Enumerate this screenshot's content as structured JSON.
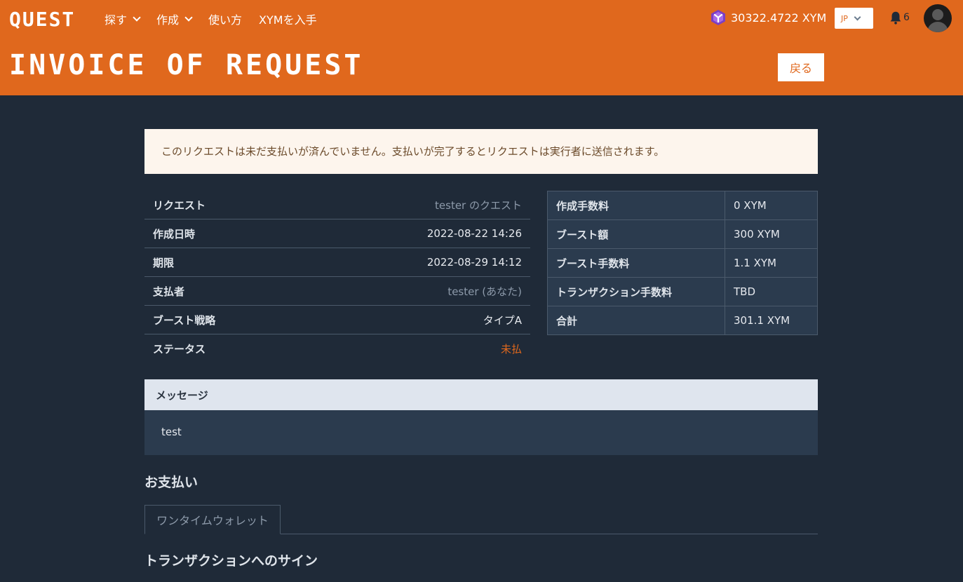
{
  "header": {
    "logo": "QUEST",
    "nav": [
      {
        "label": "探す",
        "dropdown": true
      },
      {
        "label": "作成",
        "dropdown": true
      },
      {
        "label": "使い方",
        "dropdown": false
      },
      {
        "label": "XYMを入手",
        "dropdown": false
      }
    ],
    "balance": "30322.4722 XYM",
    "language": "JP",
    "notification_count": "6",
    "page_title": "INVOICE OF REQUEST",
    "back_label": "戻る"
  },
  "notice": "このリクエストは未だ支払いが済んでいません。支払いが完了するとリクエストは実行者に送信されます。",
  "details": [
    {
      "label": "リクエスト",
      "value": "tester のクエスト"
    },
    {
      "label": "作成日時",
      "value": "2022-08-22 14:26"
    },
    {
      "label": "期限",
      "value": "2022-08-29 14:12"
    },
    {
      "label": "支払者",
      "value": "tester (あなた)"
    },
    {
      "label": "ブースト戦略",
      "value": "タイプA"
    },
    {
      "label": "ステータス",
      "value": "未払"
    }
  ],
  "fees": [
    {
      "label": "作成手数料",
      "value": "0 XYM"
    },
    {
      "label": "ブースト額",
      "value": "300 XYM"
    },
    {
      "label": "ブースト手数料",
      "value": "1.1 XYM"
    },
    {
      "label": "トランザクション手数料",
      "value": "TBD"
    },
    {
      "label": "合計",
      "value": "301.1 XYM"
    }
  ],
  "message": {
    "title": "メッセージ",
    "body": "test"
  },
  "payment": {
    "title": "お支払い",
    "tabs": [
      "ワンタイムウォレット"
    ],
    "sign_title": "トランザクションへのサイン"
  },
  "colors": {
    "brand": "#e0681d",
    "background": "#1f2a38",
    "status_unpaid": "#e0681d"
  }
}
